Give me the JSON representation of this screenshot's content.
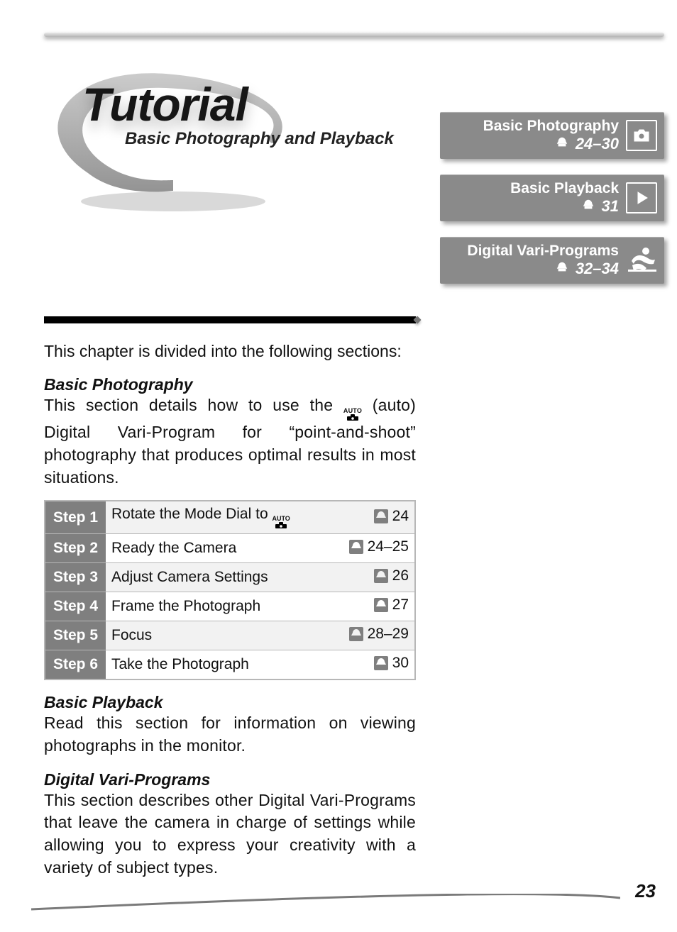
{
  "header": {
    "title": "Tutorial",
    "subtitle": "Basic Photography and Playback"
  },
  "nav": [
    {
      "title": "Basic Photography",
      "pages": "24–30",
      "icon": "camera"
    },
    {
      "title": "Basic Playback",
      "pages": "31",
      "icon": "play"
    },
    {
      "title": "Digital Vari-Programs",
      "pages": "32–34",
      "icon": "figure"
    }
  ],
  "intro": "This chapter is divided into the following sections:",
  "sections": {
    "bp": {
      "title": "Basic Photography",
      "text_a": "This section details how to use the ",
      "text_b": " (auto) Digital Vari-Program for “point-and-shoot” photography that produces optimal results in most situations.",
      "auto_label": "AUTO"
    },
    "steps": [
      {
        "step": "Step 1",
        "desc": "Rotate the Mode Dial to ",
        "auto": true,
        "pages": "24"
      },
      {
        "step": "Step 2",
        "desc": "Ready the Camera",
        "pages": "24–25"
      },
      {
        "step": "Step 3",
        "desc": "Adjust Camera Settings",
        "pages": "26"
      },
      {
        "step": "Step 4",
        "desc": "Frame the Photograph",
        "pages": "27"
      },
      {
        "step": "Step 5",
        "desc": "Focus",
        "pages": "28–29"
      },
      {
        "step": "Step 6",
        "desc": "Take the Photograph",
        "pages": "30"
      }
    ],
    "pb": {
      "title": "Basic Playback",
      "text": "Read this section for information on viewing photographs in the monitor."
    },
    "dvp": {
      "title": "Digital Vari-Programs",
      "text": "This section describes other Digital Vari-Programs that leave the camera in charge of settings while allowing you to express your creativity with a variety of subject types."
    }
  },
  "page_number": "23"
}
